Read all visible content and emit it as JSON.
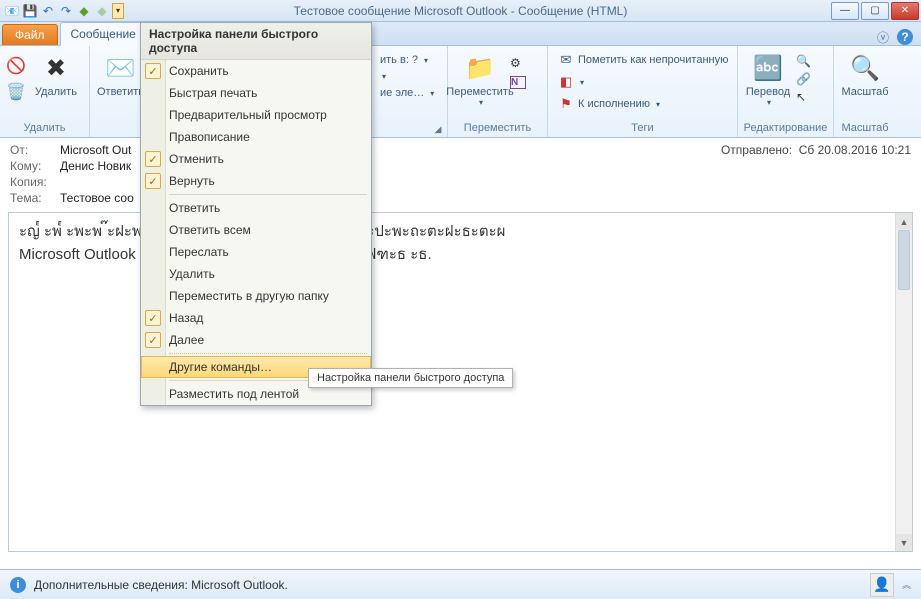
{
  "window": {
    "title": "Тестовое сообщение Microsoft Outlook - Сообщение (HTML)"
  },
  "tabs": {
    "file": "Файл",
    "message": "Сообщение"
  },
  "ribbon": {
    "delete_group": "Удалить",
    "delete_btn": "Удалить",
    "respond_btn": "Ответить",
    "move_group": "Переместить",
    "move_btn": "Переместить",
    "move_item1": "ить в: ?",
    "move_item3": "ие эле…",
    "tags_group": "Теги",
    "mark_unread": "Пометить как непрочитанную",
    "followup": "К исполнению",
    "edit_group": "Редактирование",
    "translate": "Перевод",
    "zoom_group": "Масштаб",
    "zoom_btn": "Масштаб"
  },
  "headers": {
    "from_label": "От:",
    "from_value": "Microsoft Out",
    "to_label": "Кому:",
    "to_value": "Денис Новик",
    "cc_label": "Копия:",
    "cc_value": "",
    "subject_label": "Тема:",
    "subject_value": "Тестовое соо",
    "sent_label": "Отправлено:",
    "sent_value": "Сб 20.08.2016 10:21"
  },
  "body": {
    "line1": "ะญ๎   ะพ๎   ะพะพ                                                          ๊ะฝะพ ฿ฐะผ   ะพะผะฐ   ะธ   ะด   ะบะธ ะฟ€ะธะปะพะถะตะฝะธะตะผ",
    "line2": "Microsoft Outlook                                              ฿ฐะผะด   ๎€ะพะญ๎   ๎   ะด   ะฝะพะผ ะทะฐฟฑะธ   ะธ."
  },
  "qat_menu": {
    "title": "Настройка панели быстрого доступа",
    "items": [
      {
        "label": "Сохранить",
        "checked": true
      },
      {
        "label": "Быстрая печать",
        "checked": false
      },
      {
        "label": "Предварительный просмотр",
        "checked": false
      },
      {
        "label": "Правописание",
        "checked": false
      },
      {
        "label": "Отменить",
        "checked": true
      },
      {
        "label": "Вернуть",
        "checked": true
      },
      {
        "label": "Ответить",
        "checked": false,
        "sep_before": true
      },
      {
        "label": "Ответить всем",
        "checked": false
      },
      {
        "label": "Переслать",
        "checked": false
      },
      {
        "label": "Удалить",
        "checked": false
      },
      {
        "label": "Переместить в другую папку",
        "checked": false
      },
      {
        "label": "Назад",
        "checked": true
      },
      {
        "label": "Далее",
        "checked": true
      },
      {
        "label": "Другие команды…",
        "highlight": true,
        "sep_before_dashed": true
      },
      {
        "label": "Разместить под лентой",
        "checked": false,
        "sep_before": true
      }
    ]
  },
  "tooltip": "Настройка панели быстрого доступа",
  "status": {
    "info": "Дополнительные сведения: Microsoft Outlook."
  }
}
